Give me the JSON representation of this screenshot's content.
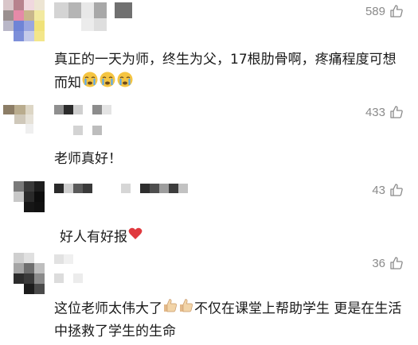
{
  "comments": [
    {
      "likes": "589",
      "text_parts": [
        "真正的一天为师，终生为父，17根肋骨啊，疼痛程度可想而知"
      ],
      "emoji": [
        "crying-face",
        "crying-face",
        "crying-face"
      ]
    },
    {
      "likes": "433",
      "text": "老师真好！"
    },
    {
      "likes": "43",
      "text": "好人有好报",
      "emoji": [
        "red-heart"
      ]
    },
    {
      "likes": "36",
      "text_a": "这位老师太伟大了",
      "text_b": "不仅在课堂上帮助学生 更是在生活中拯救了学生的生命",
      "emoji": [
        "thumbs-up",
        "thumbs-up"
      ]
    }
  ],
  "colors": {
    "text": "#1a1a1a",
    "meta": "#8a8a8a",
    "heart": "#e0393e",
    "emoji_yellow": "#f5c542",
    "thumb": "#f2d4a8"
  },
  "icons": {
    "like": "thumbs-up-outline-icon"
  }
}
